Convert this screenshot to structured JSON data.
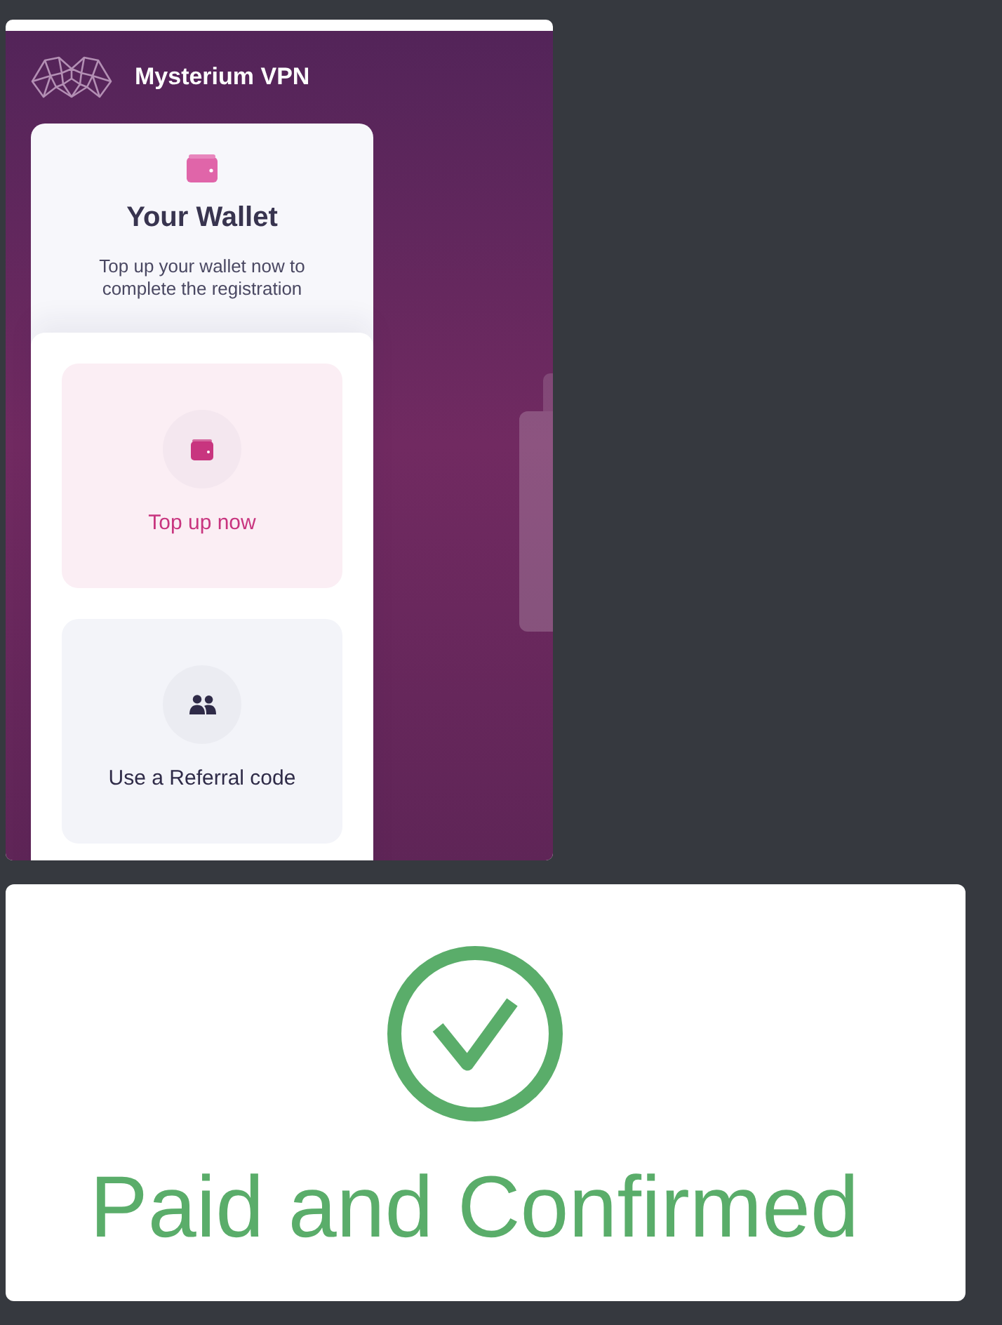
{
  "app_screenshot": {
    "header": {
      "app_name": "Mysterium VPN"
    },
    "wallet_card": {
      "title": "Your Wallet",
      "subtitle": "Top up your wallet now to complete the registration"
    },
    "options": [
      {
        "kind": "wallet",
        "label": "Top up now",
        "selected": true
      },
      {
        "kind": "referral",
        "label": "Use a Referral code",
        "selected": false
      }
    ]
  },
  "status_card": {
    "label": "Paid and Confirmed"
  }
}
